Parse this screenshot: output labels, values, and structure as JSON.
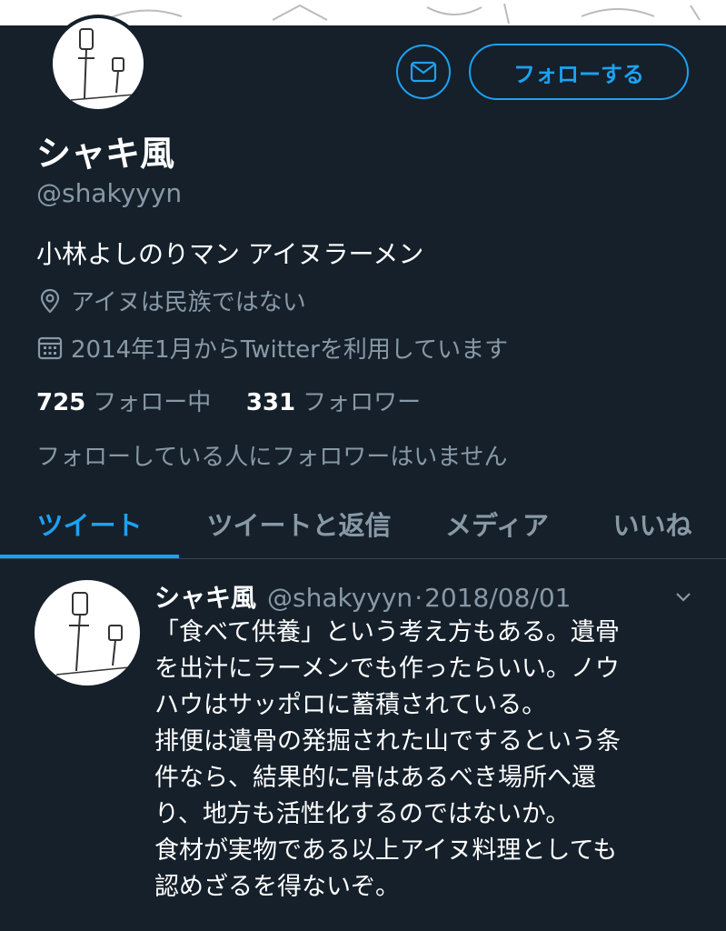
{
  "profile": {
    "display_name": "シャキ風",
    "handle": "@shakyyyn",
    "bio": "小林よしのりマン アイヌラーメン",
    "location": "アイヌは民族ではない",
    "joined": "2014年1月からTwitterを利用しています",
    "following_count": "725",
    "following_label": "フォロー中",
    "followers_count": "331",
    "followers_label": "フォロワー",
    "followers_note": "フォローしている人にフォロワーはいません"
  },
  "actions": {
    "message_icon": "envelope-icon",
    "follow_label": "フォローする"
  },
  "tabs": [
    {
      "label": "ツイート",
      "active": true
    },
    {
      "label": "ツイートと返信",
      "active": false
    },
    {
      "label": "メディア",
      "active": false
    },
    {
      "label": "いいね",
      "active": false
    }
  ],
  "tweet": {
    "name": "シャキ風",
    "handle": "@shakyyyn",
    "separator": "·",
    "date": "2018/08/01",
    "lines": [
      "「食べて供養」という考え方もある。遺骨",
      "を出汁にラーメンでも作ったらいい。ノウ",
      "ハウはサッポロに蓄積されている。",
      "排便は遺骨の発掘された山でするという条",
      "件なら、結果的に骨はあるべき場所へ還",
      "り、地方も活性化するのではないか。",
      "食材が実物である以上アイヌ料理としても",
      "認めざるを得ないぞ。"
    ]
  },
  "colors": {
    "background": "#15202b",
    "accent": "#1da1f2",
    "secondary_text": "#8899a6",
    "divider": "#38444d"
  }
}
